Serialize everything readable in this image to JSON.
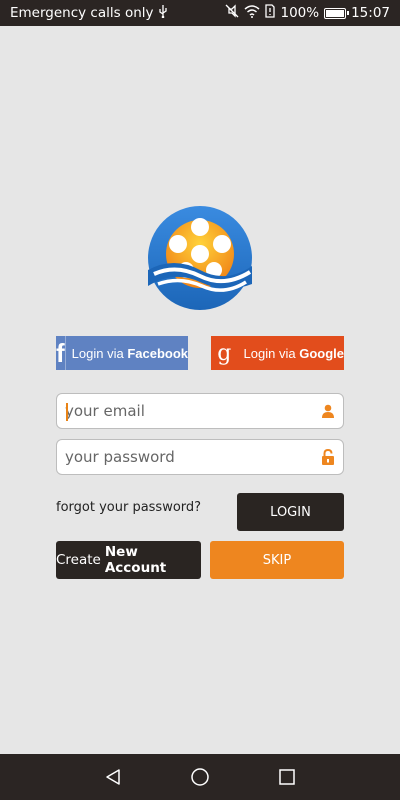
{
  "status_bar": {
    "carrier": "Emergency calls only",
    "battery_percent": "100%",
    "time": "15:07"
  },
  "social": {
    "facebook_prefix": "Login via",
    "facebook_bold": "Facebook",
    "google_prefix": "Login via",
    "google_bold": "Google",
    "facebook_color": "#5f82c2",
    "google_color": "#e24d1c"
  },
  "form": {
    "email_placeholder": "your email",
    "email_value": "",
    "password_placeholder": "your password",
    "password_value": "",
    "forgot_label": "forgot your password?",
    "login_label": "LOGIN",
    "create_prefix": "Create",
    "create_bold": "New Account",
    "skip_label": "SKIP"
  },
  "colors": {
    "accent": "#ee861f",
    "dark": "#2a2522",
    "background": "#e6e6e6"
  },
  "icons": [
    "usb-icon",
    "mute-icon",
    "wifi-icon",
    "sim-icon",
    "battery-icon",
    "logo-icon",
    "facebook-icon",
    "google-icon",
    "user-icon",
    "lock-icon",
    "back-icon",
    "home-icon",
    "recents-icon"
  ]
}
